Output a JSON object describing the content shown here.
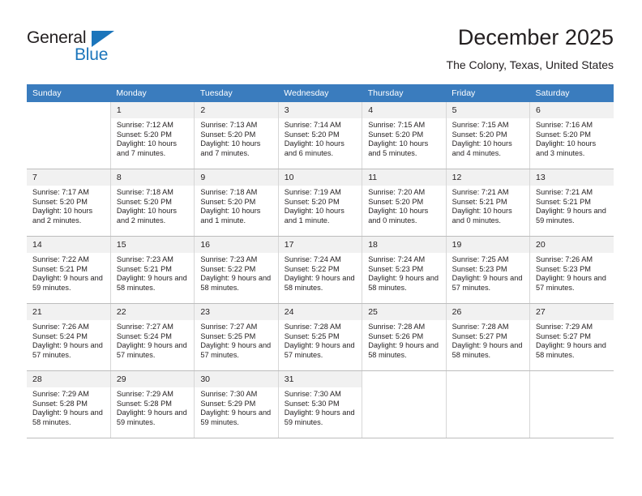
{
  "brand": {
    "name_top": "General",
    "name_bottom": "Blue",
    "accent_color": "#1b75bb"
  },
  "header": {
    "title": "December 2025",
    "subtitle": "The Colony, Texas, United States"
  },
  "calendar": {
    "header_bg": "#3a7cbe",
    "daynum_bg": "#f1f1f1",
    "weekday_headers": [
      "Sunday",
      "Monday",
      "Tuesday",
      "Wednesday",
      "Thursday",
      "Friday",
      "Saturday"
    ],
    "weeks": [
      [
        {
          "day": "",
          "sunrise": "",
          "sunset": "",
          "daylight": "",
          "empty": true
        },
        {
          "day": "1",
          "sunrise": "Sunrise: 7:12 AM",
          "sunset": "Sunset: 5:20 PM",
          "daylight": "Daylight: 10 hours and 7 minutes."
        },
        {
          "day": "2",
          "sunrise": "Sunrise: 7:13 AM",
          "sunset": "Sunset: 5:20 PM",
          "daylight": "Daylight: 10 hours and 7 minutes."
        },
        {
          "day": "3",
          "sunrise": "Sunrise: 7:14 AM",
          "sunset": "Sunset: 5:20 PM",
          "daylight": "Daylight: 10 hours and 6 minutes."
        },
        {
          "day": "4",
          "sunrise": "Sunrise: 7:15 AM",
          "sunset": "Sunset: 5:20 PM",
          "daylight": "Daylight: 10 hours and 5 minutes."
        },
        {
          "day": "5",
          "sunrise": "Sunrise: 7:15 AM",
          "sunset": "Sunset: 5:20 PM",
          "daylight": "Daylight: 10 hours and 4 minutes."
        },
        {
          "day": "6",
          "sunrise": "Sunrise: 7:16 AM",
          "sunset": "Sunset: 5:20 PM",
          "daylight": "Daylight: 10 hours and 3 minutes."
        }
      ],
      [
        {
          "day": "7",
          "sunrise": "Sunrise: 7:17 AM",
          "sunset": "Sunset: 5:20 PM",
          "daylight": "Daylight: 10 hours and 2 minutes."
        },
        {
          "day": "8",
          "sunrise": "Sunrise: 7:18 AM",
          "sunset": "Sunset: 5:20 PM",
          "daylight": "Daylight: 10 hours and 2 minutes."
        },
        {
          "day": "9",
          "sunrise": "Sunrise: 7:18 AM",
          "sunset": "Sunset: 5:20 PM",
          "daylight": "Daylight: 10 hours and 1 minute."
        },
        {
          "day": "10",
          "sunrise": "Sunrise: 7:19 AM",
          "sunset": "Sunset: 5:20 PM",
          "daylight": "Daylight: 10 hours and 1 minute."
        },
        {
          "day": "11",
          "sunrise": "Sunrise: 7:20 AM",
          "sunset": "Sunset: 5:20 PM",
          "daylight": "Daylight: 10 hours and 0 minutes."
        },
        {
          "day": "12",
          "sunrise": "Sunrise: 7:21 AM",
          "sunset": "Sunset: 5:21 PM",
          "daylight": "Daylight: 10 hours and 0 minutes."
        },
        {
          "day": "13",
          "sunrise": "Sunrise: 7:21 AM",
          "sunset": "Sunset: 5:21 PM",
          "daylight": "Daylight: 9 hours and 59 minutes."
        }
      ],
      [
        {
          "day": "14",
          "sunrise": "Sunrise: 7:22 AM",
          "sunset": "Sunset: 5:21 PM",
          "daylight": "Daylight: 9 hours and 59 minutes."
        },
        {
          "day": "15",
          "sunrise": "Sunrise: 7:23 AM",
          "sunset": "Sunset: 5:21 PM",
          "daylight": "Daylight: 9 hours and 58 minutes."
        },
        {
          "day": "16",
          "sunrise": "Sunrise: 7:23 AM",
          "sunset": "Sunset: 5:22 PM",
          "daylight": "Daylight: 9 hours and 58 minutes."
        },
        {
          "day": "17",
          "sunrise": "Sunrise: 7:24 AM",
          "sunset": "Sunset: 5:22 PM",
          "daylight": "Daylight: 9 hours and 58 minutes."
        },
        {
          "day": "18",
          "sunrise": "Sunrise: 7:24 AM",
          "sunset": "Sunset: 5:23 PM",
          "daylight": "Daylight: 9 hours and 58 minutes."
        },
        {
          "day": "19",
          "sunrise": "Sunrise: 7:25 AM",
          "sunset": "Sunset: 5:23 PM",
          "daylight": "Daylight: 9 hours and 57 minutes."
        },
        {
          "day": "20",
          "sunrise": "Sunrise: 7:26 AM",
          "sunset": "Sunset: 5:23 PM",
          "daylight": "Daylight: 9 hours and 57 minutes."
        }
      ],
      [
        {
          "day": "21",
          "sunrise": "Sunrise: 7:26 AM",
          "sunset": "Sunset: 5:24 PM",
          "daylight": "Daylight: 9 hours and 57 minutes."
        },
        {
          "day": "22",
          "sunrise": "Sunrise: 7:27 AM",
          "sunset": "Sunset: 5:24 PM",
          "daylight": "Daylight: 9 hours and 57 minutes."
        },
        {
          "day": "23",
          "sunrise": "Sunrise: 7:27 AM",
          "sunset": "Sunset: 5:25 PM",
          "daylight": "Daylight: 9 hours and 57 minutes."
        },
        {
          "day": "24",
          "sunrise": "Sunrise: 7:28 AM",
          "sunset": "Sunset: 5:25 PM",
          "daylight": "Daylight: 9 hours and 57 minutes."
        },
        {
          "day": "25",
          "sunrise": "Sunrise: 7:28 AM",
          "sunset": "Sunset: 5:26 PM",
          "daylight": "Daylight: 9 hours and 58 minutes."
        },
        {
          "day": "26",
          "sunrise": "Sunrise: 7:28 AM",
          "sunset": "Sunset: 5:27 PM",
          "daylight": "Daylight: 9 hours and 58 minutes."
        },
        {
          "day": "27",
          "sunrise": "Sunrise: 7:29 AM",
          "sunset": "Sunset: 5:27 PM",
          "daylight": "Daylight: 9 hours and 58 minutes."
        }
      ],
      [
        {
          "day": "28",
          "sunrise": "Sunrise: 7:29 AM",
          "sunset": "Sunset: 5:28 PM",
          "daylight": "Daylight: 9 hours and 58 minutes."
        },
        {
          "day": "29",
          "sunrise": "Sunrise: 7:29 AM",
          "sunset": "Sunset: 5:28 PM",
          "daylight": "Daylight: 9 hours and 59 minutes."
        },
        {
          "day": "30",
          "sunrise": "Sunrise: 7:30 AM",
          "sunset": "Sunset: 5:29 PM",
          "daylight": "Daylight: 9 hours and 59 minutes."
        },
        {
          "day": "31",
          "sunrise": "Sunrise: 7:30 AM",
          "sunset": "Sunset: 5:30 PM",
          "daylight": "Daylight: 9 hours and 59 minutes."
        },
        {
          "day": "",
          "sunrise": "",
          "sunset": "",
          "daylight": "",
          "empty": true
        },
        {
          "day": "",
          "sunrise": "",
          "sunset": "",
          "daylight": "",
          "empty": true
        },
        {
          "day": "",
          "sunrise": "",
          "sunset": "",
          "daylight": "",
          "empty": true
        }
      ]
    ]
  }
}
